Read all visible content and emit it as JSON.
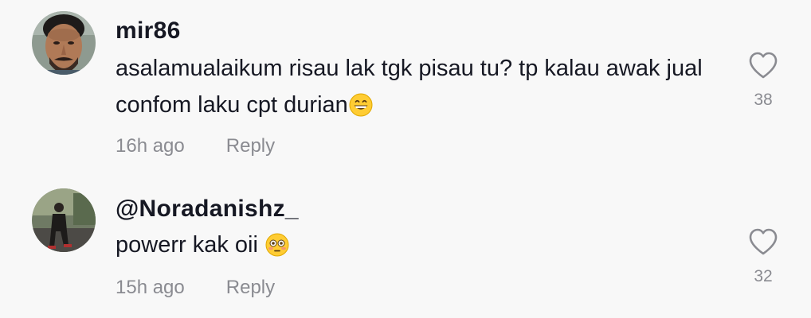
{
  "comments": [
    {
      "username": "mir86",
      "text": "asalamualaikum risau lak tgk pisau tu? tp kalau awak jual confom laku cpt durian",
      "emoji": "grinning-face-emoji",
      "time": "16h ago",
      "reply_label": "Reply",
      "likes": "38",
      "avatar_icon": "man-portrait-avatar"
    },
    {
      "username": "@Noradanishz_",
      "text": "powerr kak oii ",
      "emoji": "flushed-face-emoji",
      "time": "15h ago",
      "reply_label": "Reply",
      "likes": "32",
      "avatar_icon": "person-outdoor-avatar"
    }
  ],
  "colors": {
    "background": "#f8f8f8",
    "primary_text": "#161823",
    "secondary_text": "#8a8b91"
  }
}
